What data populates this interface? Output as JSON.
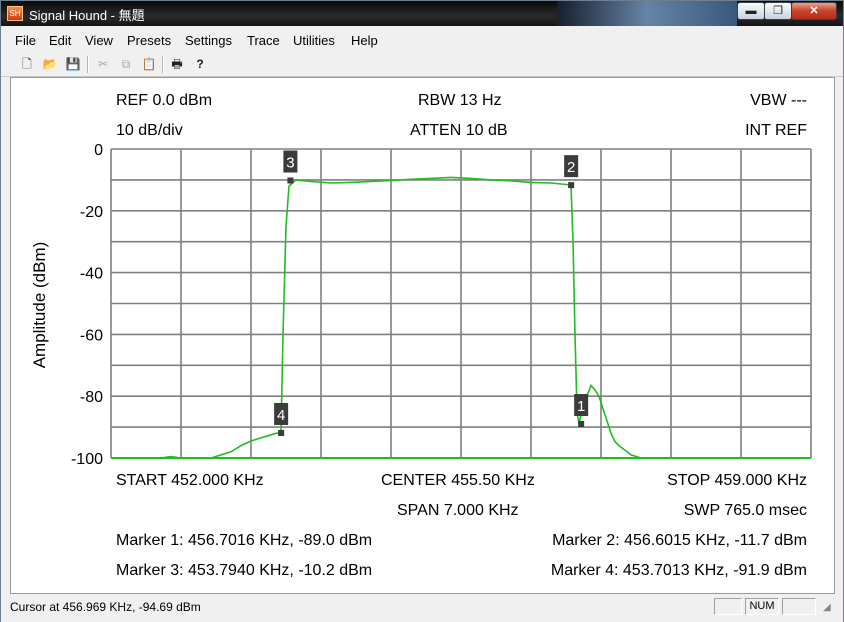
{
  "window": {
    "title": "Signal Hound - 無題",
    "icon": "signal-hound-app-icon"
  },
  "title_buttons": {
    "minimize": "▬",
    "restore": "❐",
    "close": "✕"
  },
  "menu": [
    {
      "label": "File",
      "key": "file"
    },
    {
      "label": "Edit",
      "key": "edit"
    },
    {
      "label": "View",
      "key": "view"
    },
    {
      "label": "Presets",
      "key": "presets"
    },
    {
      "label": "Settings",
      "key": "settings"
    },
    {
      "label": "Trace",
      "key": "trace"
    },
    {
      "label": "Utilities",
      "key": "utilities"
    },
    {
      "label": "Help",
      "key": "help"
    }
  ],
  "toolbar": {
    "icons": [
      "new-file-icon",
      "open-folder-icon",
      "save-disk-icon",
      "cut-icon",
      "copy-icon",
      "paste-icon",
      "print-icon",
      "help-question-icon"
    ],
    "glyphs": {
      "new": "🗋",
      "open": "📂",
      "save": "💾",
      "cut": "✂",
      "copy": "⧉",
      "paste": "📋",
      "print": "🖶",
      "help": "?"
    }
  },
  "display": {
    "ref_level": "REF 0.0 dBm",
    "scale": "10 dB/div",
    "rbw": "RBW 13 Hz",
    "atten": "ATTEN 10 dB",
    "vbw": "VBW ---",
    "ref_source": "INT REF",
    "start": "START 452.000 KHz",
    "center": "CENTER 455.50 KHz",
    "stop": "STOP 459.000 KHz",
    "span": "SPAN 7.000 KHz",
    "sweep": "SWP 765.0 msec"
  },
  "markers_readout": {
    "m1": "Marker 1: 456.7016 KHz, -89.0 dBm",
    "m2": "Marker 2: 456.6015 KHz, -11.7 dBm",
    "m3": "Marker 3: 453.7940 KHz, -10.2 dBm",
    "m4": "Marker 4: 453.7013 KHz, -91.9 dBm"
  },
  "chart_data": {
    "type": "line",
    "ylabel": "Amplitude (dBm)",
    "ylim": [
      -100,
      0
    ],
    "xlim": [
      452.0,
      459.0
    ],
    "x_unit": "KHz",
    "y_ticks": [
      "0",
      "-20",
      "-40",
      "-60",
      "-80",
      "-100"
    ],
    "y_tick_values": [
      0,
      -20,
      -40,
      -60,
      -80,
      -100
    ],
    "x_divisions": 10,
    "y_divisions": 10,
    "grid": true,
    "trace_color": "#22bb22",
    "grid_color": "#808080",
    "series": [
      {
        "x": [
          452.0,
          452.5,
          452.6,
          452.7,
          452.8,
          452.9,
          453.0,
          453.1,
          453.2,
          453.3,
          453.4,
          453.5,
          453.6,
          453.65,
          453.7,
          453.72,
          453.75,
          453.78,
          453.85,
          454.0,
          454.2,
          454.4,
          454.6,
          454.8,
          455.0,
          455.2,
          455.4,
          455.6,
          455.8,
          456.0,
          456.2,
          456.4,
          456.55,
          456.6,
          456.62,
          456.64,
          456.66,
          456.68,
          456.7,
          456.72,
          456.76,
          456.8,
          456.84,
          456.88,
          456.92,
          456.96,
          457.0,
          457.04,
          457.08,
          457.12,
          457.16,
          457.2,
          457.3,
          457.5,
          458.0,
          459.0
        ],
        "y": [
          -100,
          -100,
          -99.5,
          -100,
          -100,
          -100,
          -100,
          -99,
          -98,
          -96,
          -94.5,
          -93.5,
          -92.5,
          -92,
          -91.9,
          -60,
          -25,
          -12,
          -10,
          -10.5,
          -11,
          -10.8,
          -10.5,
          -10.2,
          -9.8,
          -9.5,
          -9.2,
          -9.5,
          -10,
          -10.3,
          -10.8,
          -11,
          -11.5,
          -11.7,
          -30,
          -60,
          -85,
          -89,
          -86,
          -83,
          -80,
          -76.5,
          -78,
          -80,
          -84,
          -88,
          -92,
          -94.7,
          -96,
          -97,
          -98,
          -99,
          -100,
          -100,
          -100,
          -100
        ]
      }
    ],
    "markers": [
      {
        "id": "1",
        "x": 456.7016,
        "y": -89.0
      },
      {
        "id": "2",
        "x": 456.6015,
        "y": -11.7
      },
      {
        "id": "3",
        "x": 453.794,
        "y": -10.2
      },
      {
        "id": "4",
        "x": 453.7013,
        "y": -91.9
      }
    ]
  },
  "status": {
    "cursor": "Cursor at 456.969 KHz, -94.69 dBm",
    "num": "NUM"
  }
}
